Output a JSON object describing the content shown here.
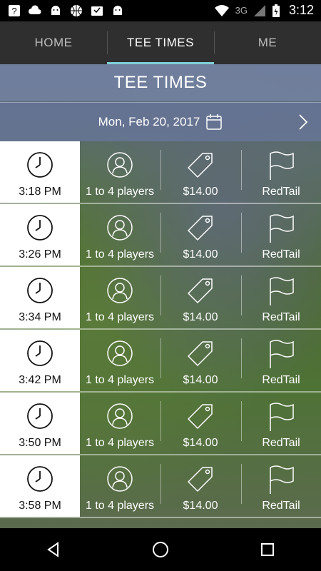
{
  "status_bar": {
    "network": "3G",
    "time": "3:12",
    "icons": [
      "help-icon",
      "cloud-icon",
      "android-icon",
      "basketball-icon",
      "inbox-icon",
      "android-icon",
      "wifi-icon",
      "signal-icon",
      "battery-icon"
    ]
  },
  "tabs": [
    {
      "label": "HOME",
      "active": false
    },
    {
      "label": "TEE TIMES",
      "active": true
    },
    {
      "label": "ME",
      "active": false
    }
  ],
  "header": {
    "title": "TEE TIMES"
  },
  "date_bar": {
    "date": "Mon, Feb 20, 2017"
  },
  "tee_times": [
    {
      "time": "3:18 PM",
      "players": "1 to 4 players",
      "price": "$14.00",
      "course": "RedTail"
    },
    {
      "time": "3:26 PM",
      "players": "1 to 4 players",
      "price": "$14.00",
      "course": "RedTail"
    },
    {
      "time": "3:34 PM",
      "players": "1 to 4 players",
      "price": "$14.00",
      "course": "RedTail"
    },
    {
      "time": "3:42 PM",
      "players": "1 to 4 players",
      "price": "$14.00",
      "course": "RedTail"
    },
    {
      "time": "3:50 PM",
      "players": "1 to 4 players",
      "price": "$14.00",
      "course": "RedTail"
    },
    {
      "time": "3:58 PM",
      "players": "1 to 4 players",
      "price": "$14.00",
      "course": "RedTail"
    }
  ],
  "colors": {
    "tab_indicator": "#7fd0d6",
    "tab_bar": "#2f2f2f",
    "header_overlay": "#7887aa"
  }
}
